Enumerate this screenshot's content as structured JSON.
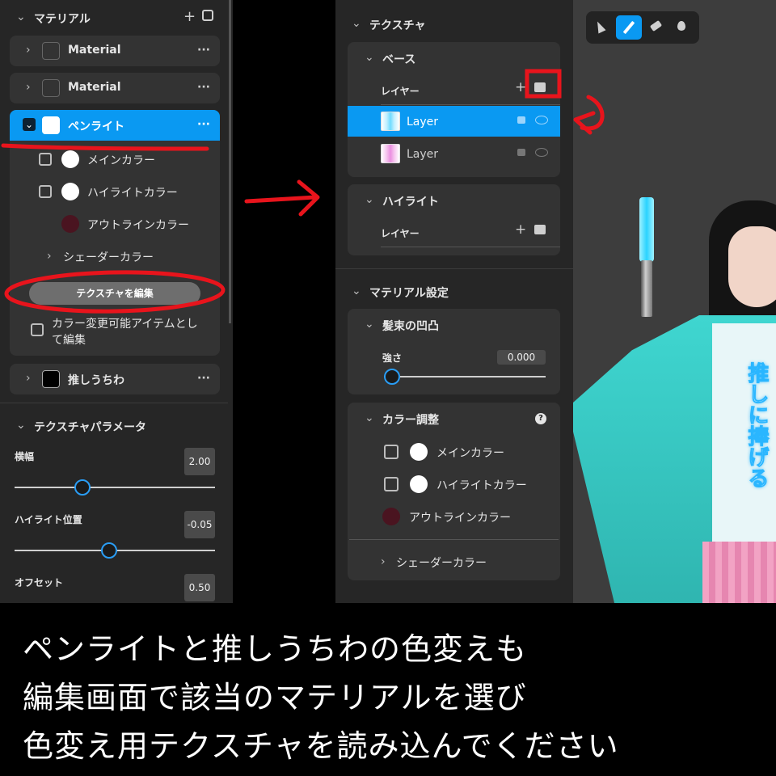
{
  "left_panel": {
    "header": "マテリアル",
    "materials": [
      {
        "name": "Material"
      },
      {
        "name": "Material"
      },
      {
        "name": "ペンライト"
      },
      {
        "name": "推しうちわ"
      }
    ],
    "more_label": "···",
    "sub_items": {
      "main_color": "メインカラー",
      "highlight_color": "ハイライトカラー",
      "outline_color": "アウトラインカラー",
      "shader_color": "シェーダーカラー"
    },
    "edit_texture_button": "テクスチャを編集",
    "color_changeable_label_1": "カラー変更可能アイテムとし",
    "color_changeable_label_2": "て編集",
    "texture_params": {
      "header": "テクスチャパラメータ",
      "width_label": "横幅",
      "width_value": "2.00",
      "width_slider": 0.34,
      "highlight_pos_label": "ハイライト位置",
      "highlight_pos_value": "-0.05",
      "highlight_pos_slider": 0.47,
      "offset_label": "オフセット",
      "offset_value": "0.50"
    }
  },
  "right_panel": {
    "texture_header": "テクスチャ",
    "base_section": "ベース",
    "layer_label": "レイヤー",
    "layers": [
      {
        "name": "Layer",
        "selected": true
      },
      {
        "name": "Layer",
        "selected": false
      }
    ],
    "highlight_section": "ハイライト",
    "highlight_layer_label": "レイヤー",
    "material_settings_header": "マテリアル設定",
    "hair_bump_section": "髪束の凹凸",
    "strength_label": "強さ",
    "strength_value": "0.000",
    "strength_slider": 0.0,
    "color_adjust_section": "カラー調整",
    "main_color": "メインカラー",
    "highlight_color": "ハイライトカラー",
    "outline_color": "アウトラインカラー",
    "shader_color": "シェーダーカラー"
  },
  "toolbar": {
    "tools": [
      "cursor-icon",
      "pen-icon",
      "eraser-icon",
      "dropper-icon"
    ],
    "active_tool": "pen-icon"
  },
  "viewport": {
    "uchiwa_text": "推しに捧げる"
  },
  "caption": {
    "line1": "ペンライトと推しうちわの色変えも",
    "line2": "編集画面で該当のマテリアルを選び",
    "line3": "色変え用テクスチャを読み込んでください"
  },
  "colors": {
    "accent": "#0a99f2",
    "panel": "#262626",
    "card": "#333333",
    "annotation_red": "#e8141c",
    "outline_swatch": "#4a1420"
  }
}
